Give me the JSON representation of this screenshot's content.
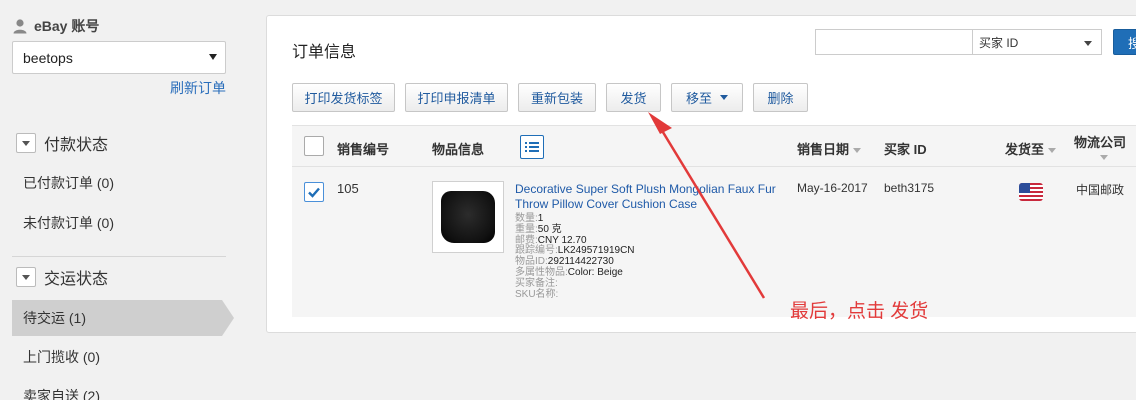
{
  "sidebar": {
    "account_label": "eBay 账号",
    "account_value": "beetops",
    "refresh_link": "刷新订单",
    "payment_section": {
      "title": "付款状态",
      "items": [
        {
          "label": "已付款订单 (0)"
        },
        {
          "label": "未付款订单 (0)"
        }
      ]
    },
    "delivery_section": {
      "title": "交运状态",
      "items": [
        {
          "label": "待交运 (1)",
          "active": true
        },
        {
          "label": "上门揽收 (0)"
        },
        {
          "label": "卖家自送 (2)"
        }
      ]
    }
  },
  "panel": {
    "title": "订单信息",
    "search": {
      "value": "",
      "select_value": "买家 ID",
      "button_label": "搜"
    },
    "toolbar": {
      "print_label": "打印发货标签",
      "print_customs": "打印申报清单",
      "repack": "重新包装",
      "ship": "发货",
      "move_to": "移至",
      "delete": "删除"
    },
    "table": {
      "headers": {
        "sale_no": "销售编号",
        "item_info": "物品信息",
        "sale_date": "销售日期",
        "buyer_id": "买家 ID",
        "ship_to": "发货至",
        "logistics": "物流公司"
      },
      "rows": [
        {
          "checked": true,
          "sale_no": "105",
          "title": "Decorative Super Soft Plush Mongolian Faux Fur Throw Pillow Cover Cushion Case",
          "meta": {
            "qty_label": "数量:",
            "qty": "1",
            "weight_label": "重量:",
            "weight": "50 克",
            "postage_label": "邮费:",
            "postage": "CNY 12.70",
            "tracking_label": "跟踪编号:",
            "tracking": "LK249571919CN",
            "item_id_label": "物品ID:",
            "item_id": "292114422730",
            "variation_label": "多属性物品:",
            "variation": "Color: Beige",
            "buyer_note_label": "买家备注:",
            "buyer_note": "",
            "sku_label": "SKU名称:",
            "sku": ""
          },
          "sale_date": "May-16-2017",
          "buyer_id": "beth3175",
          "logistics": "中国邮政"
        }
      ]
    }
  },
  "annotation": {
    "text": "最后，点击 发货",
    "color": "#e23a3a"
  },
  "colors": {
    "accent": "#1f6eb7",
    "link": "#1f5aa8"
  }
}
